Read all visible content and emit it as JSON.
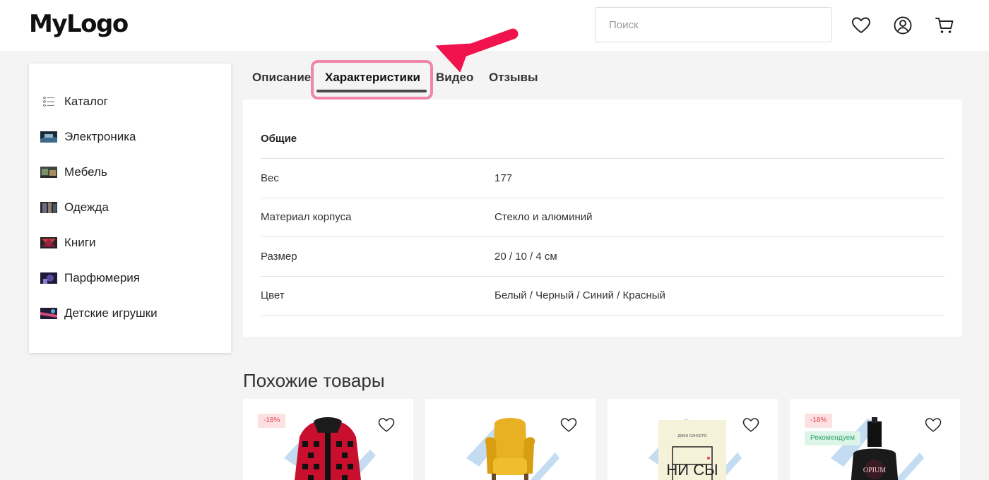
{
  "header": {
    "logo": "MyLogo",
    "search_placeholder": "Поиск",
    "icons": [
      "heart-icon",
      "user-icon",
      "cart-icon"
    ]
  },
  "sidebar": {
    "items": [
      {
        "label": "Каталог",
        "icon": "list-icon"
      },
      {
        "label": "Электроника",
        "icon": "electronics-thumb"
      },
      {
        "label": "Мебель",
        "icon": "furniture-thumb"
      },
      {
        "label": "Одежда",
        "icon": "clothes-thumb"
      },
      {
        "label": "Книги",
        "icon": "books-thumb"
      },
      {
        "label": "Парфюмерия",
        "icon": "perfume-thumb"
      },
      {
        "label": "Детские игрушки",
        "icon": "toys-thumb"
      }
    ]
  },
  "tabs": [
    {
      "label": "Описание",
      "active": false
    },
    {
      "label": "Характеристики",
      "active": true
    },
    {
      "label": "Видео",
      "active": false
    },
    {
      "label": "Отзывы",
      "active": false
    }
  ],
  "specs": {
    "group": "Общие",
    "rows": [
      {
        "key": "Вес",
        "value": "177"
      },
      {
        "key": "Материал корпуса",
        "value": "Стекло и алюминий"
      },
      {
        "key": "Размер",
        "value": "20 / 10 / 4 см"
      },
      {
        "key": "Цвет",
        "value": "Белый / Черный / Синий / Красный"
      }
    ]
  },
  "similar": {
    "title": "Похожие товары",
    "cards": [
      {
        "image": "hoodie",
        "discount": "-18%",
        "tag": ""
      },
      {
        "image": "yellow-armchair",
        "discount": "",
        "tag": ""
      },
      {
        "image": "book",
        "discount": "",
        "tag": "",
        "book_text": "НИ СЫ",
        "book_author": "ДЖЕН СИНСЕРО"
      },
      {
        "image": "perfume",
        "discount": "-18%",
        "tag": "Рекомендуем",
        "perfume_text": "OPIUM"
      }
    ]
  },
  "colors": {
    "highlight": "#f087a8",
    "arrow": "#f0134d",
    "discount_text": "#e2474f",
    "reco_text": "#2aa365",
    "tab_underline": "#4a4a4a"
  }
}
